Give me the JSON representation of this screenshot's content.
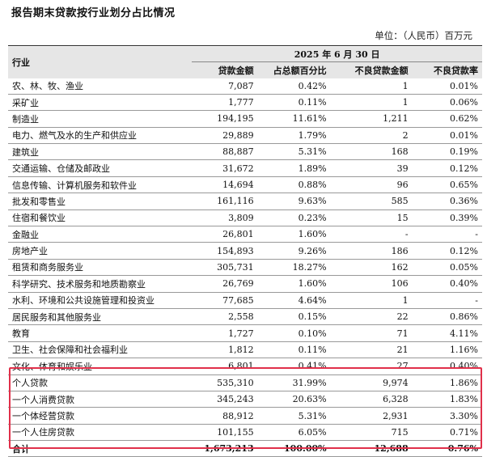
{
  "title": "报告期末贷款按行业划分占比情况",
  "unit": "单位：（人民币）百万元",
  "header": {
    "industry": "行业",
    "date": "2025 年 6 月 30 日",
    "columns": [
      "贷款金额",
      "占总额百分比",
      "不良贷款金额",
      "不良贷款率"
    ]
  },
  "rows": [
    {
      "industry": "农、林、牧、渔业",
      "amount": "7,087",
      "pct": "0.42%",
      "npl": "1",
      "rate": "0.01%"
    },
    {
      "industry": "采矿业",
      "amount": "1,777",
      "pct": "0.11%",
      "npl": "1",
      "rate": "0.06%"
    },
    {
      "industry": "制造业",
      "amount": "194,195",
      "pct": "11.61%",
      "npl": "1,211",
      "rate": "0.62%"
    },
    {
      "industry": "电力、燃气及水的生产和供应业",
      "amount": "29,889",
      "pct": "1.79%",
      "npl": "2",
      "rate": "0.01%"
    },
    {
      "industry": "建筑业",
      "amount": "88,887",
      "pct": "5.31%",
      "npl": "168",
      "rate": "0.19%"
    },
    {
      "industry": "交通运输、仓储及邮政业",
      "amount": "31,672",
      "pct": "1.89%",
      "npl": "39",
      "rate": "0.12%"
    },
    {
      "industry": "信息传输、计算机服务和软件业",
      "amount": "14,694",
      "pct": "0.88%",
      "npl": "96",
      "rate": "0.65%"
    },
    {
      "industry": "批发和零售业",
      "amount": "161,116",
      "pct": "9.63%",
      "npl": "585",
      "rate": "0.36%"
    },
    {
      "industry": "住宿和餐饮业",
      "amount": "3,809",
      "pct": "0.23%",
      "npl": "15",
      "rate": "0.39%"
    },
    {
      "industry": "金融业",
      "amount": "26,801",
      "pct": "1.60%",
      "npl": "-",
      "rate": "-"
    },
    {
      "industry": "房地产业",
      "amount": "154,893",
      "pct": "9.26%",
      "npl": "186",
      "rate": "0.12%"
    },
    {
      "industry": "租赁和商务服务业",
      "amount": "305,731",
      "pct": "18.27%",
      "npl": "162",
      "rate": "0.05%"
    },
    {
      "industry": "科学研究、技术服务和地质勘察业",
      "amount": "26,769",
      "pct": "1.60%",
      "npl": "106",
      "rate": "0.40%"
    },
    {
      "industry": "水利、环境和公共设施管理和投资业",
      "amount": "77,685",
      "pct": "4.64%",
      "npl": "1",
      "rate": "-"
    },
    {
      "industry": "居民服务和其他服务业",
      "amount": "2,558",
      "pct": "0.15%",
      "npl": "22",
      "rate": "0.86%"
    },
    {
      "industry": "教育",
      "amount": "1,727",
      "pct": "0.10%",
      "npl": "71",
      "rate": "4.11%"
    },
    {
      "industry": "卫生、社会保障和社会福利业",
      "amount": "1,812",
      "pct": "0.11%",
      "npl": "21",
      "rate": "1.16%"
    },
    {
      "industry": "文化、体育和娱乐业",
      "amount": "6,801",
      "pct": "0.41%",
      "npl": "27",
      "rate": "0.40%"
    }
  ],
  "personal": [
    {
      "industry": "个人贷款",
      "amount": "535,310",
      "pct": "31.99%",
      "npl": "9,974",
      "rate": "1.86%"
    },
    {
      "industry": "一个人消费贷款",
      "amount": "345,243",
      "pct": "20.63%",
      "npl": "6,328",
      "rate": "1.83%"
    },
    {
      "industry": "一个体经营贷款",
      "amount": "88,912",
      "pct": "5.31%",
      "npl": "2,931",
      "rate": "3.30%"
    },
    {
      "industry": "一个人住房贷款",
      "amount": "101,155",
      "pct": "6.05%",
      "npl": "715",
      "rate": "0.71%"
    }
  ],
  "total": {
    "industry": "合计",
    "amount": "1,673,213",
    "pct": "100.00%",
    "npl": "12,688",
    "rate": "0.76%"
  }
}
